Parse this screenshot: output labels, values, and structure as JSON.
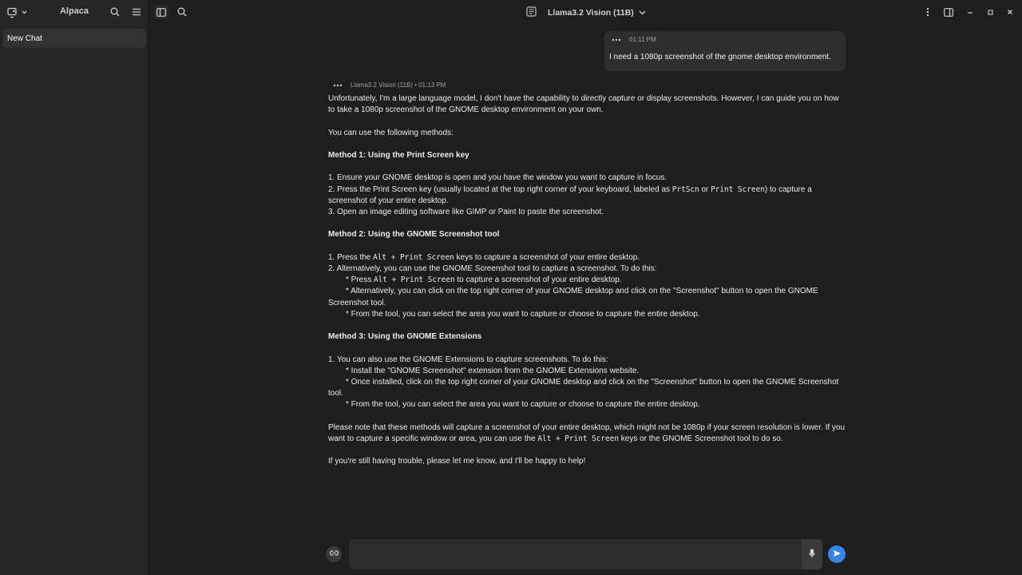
{
  "sidebar": {
    "app_title": "Alpaca",
    "chats": [
      {
        "label": "New Chat"
      }
    ]
  },
  "header": {
    "model_label": "Llama3.2 Vision (11B)"
  },
  "user_message": {
    "time": "01:11 PM",
    "text": "I need a 1080p screenshot of the gnome desktop environment."
  },
  "bot_message": {
    "meta": "Llama3.2 Vision (11B) • 01:13 PM",
    "p1": "Unfortunately, I'm a large language model, I don't have the capability to directly capture or display screenshots. However, I can guide you on how to take a 1080p screenshot of the GNOME desktop environment on your own.",
    "p2": "You can use the following methods:",
    "m1_title": "Method 1: Using the Print Screen key",
    "m1_l1": "1. Ensure your GNOME desktop is open and you have the window you want to capture in focus.",
    "m1_l2a": "2. Press the Print Screen key (usually located at the top right corner of your keyboard, labeled as ",
    "m1_code1": "PrtScn",
    "m1_l2b": " or ",
    "m1_code2": "Print Screen",
    "m1_l2c": ") to capture a screenshot of your entire desktop.",
    "m1_l3": "3. Open an image editing software like GIMP or Paint to paste the screenshot.",
    "m2_title": "Method 2: Using the GNOME Screenshot tool",
    "m2_l1a": "1. Press the ",
    "m2_code1": "Alt + Print Screen",
    "m2_l1b": " keys to capture a screenshot of your entire desktop.",
    "m2_l2": "2. Alternatively, you can use the GNOME Screenshot tool to capture a screenshot. To do this:",
    "m2_b1a": "* Press ",
    "m2_code2": "Alt + Print Screen",
    "m2_b1b": " to capture a screenshot of your entire desktop.",
    "m2_b2": "* Alternatively, you can click on the top right corner of your GNOME desktop and click on the \"Screenshot\" button to open the GNOME Screenshot tool.",
    "m2_b3": "* From the tool, you can select the area you want to capture or choose to capture the entire desktop.",
    "m3_title": "Method 3: Using the GNOME Extensions",
    "m3_l1": "1. You can also use the GNOME Extensions to capture screenshots. To do this:",
    "m3_b1": "* Install the \"GNOME Screenshot\" extension from the GNOME Extensions website.",
    "m3_b2": "* Once installed, click on the top right corner of your GNOME desktop and click on the \"Screenshot\" button to open the GNOME Screenshot tool.",
    "m3_b3": "* From the tool, you can select the area you want to capture or choose to capture the entire desktop.",
    "p3a": "Please note that these methods will capture a screenshot of your entire desktop, which might not be 1080p if your screen resolution is lower. If you want to capture a specific window or area, you can use the ",
    "p3_code": "Alt + Print Screen",
    "p3b": " keys or the GNOME Screenshot tool to do so.",
    "p4": "If you're still having trouble, please let me know, and I'll be happy to help!"
  },
  "composer": {
    "placeholder": "",
    "value": ""
  },
  "icons": {
    "new_chat": "new-chat-icon",
    "search": "search-icon",
    "menu": "hamburger-menu-icon",
    "sidebar_toggle": "sidebar-toggle-icon",
    "model_manager": "model-manager-icon",
    "more": "vertical-dots-icon",
    "panel": "panel-icon",
    "minimize": "minimize-icon",
    "maximize": "maximize-icon",
    "close": "close-icon",
    "attach": "attach-icon",
    "mic": "microphone-icon",
    "send": "send-icon"
  },
  "colors": {
    "accent": "#3584e4",
    "background": "#1e1e1e",
    "sidebar": "#262626"
  }
}
